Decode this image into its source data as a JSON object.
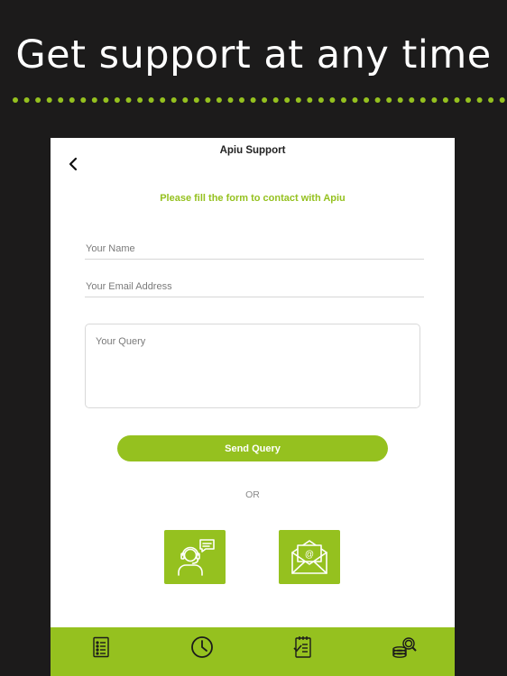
{
  "headline": "Get support at any time",
  "colors": {
    "background": "#1c1b1b",
    "accent": "#95c11f",
    "panel": "#ffffff"
  },
  "screen": {
    "title": "Apiu Support",
    "back_icon": "chevron-left-icon",
    "subtitle": "Please fill the form to contact with Apiu"
  },
  "form": {
    "name_placeholder": "Your Name",
    "email_placeholder": "Your Email Address",
    "query_placeholder": "Your Query",
    "send_label": "Send Query",
    "or_label": "OR"
  },
  "contact_options": [
    {
      "name": "support-agent",
      "icon": "support-agent-chat-icon"
    },
    {
      "name": "email",
      "icon": "envelope-at-icon"
    }
  ],
  "bottom_nav": [
    {
      "icon": "list-document-icon"
    },
    {
      "icon": "clock-icon"
    },
    {
      "icon": "notepad-checklist-icon"
    },
    {
      "icon": "coins-search-icon"
    }
  ]
}
